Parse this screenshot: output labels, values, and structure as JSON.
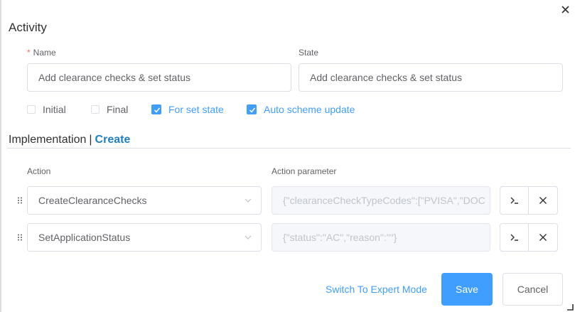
{
  "dialog": {
    "title": "Activity",
    "close_icon": "close-icon"
  },
  "form": {
    "name_label": "Name",
    "name_required_marker": "*",
    "name_value": "Add clearance checks & set status",
    "state_label": "State",
    "state_value": "Add clearance checks & set status",
    "checkboxes": [
      {
        "label": "Initial",
        "checked": false
      },
      {
        "label": "Final",
        "checked": false
      },
      {
        "label": "For set state",
        "checked": true
      },
      {
        "label": "Auto scheme update",
        "checked": true
      }
    ]
  },
  "implementation": {
    "title": "Implementation",
    "separator": "|",
    "link": "Create",
    "columns": {
      "action": "Action",
      "parameter": "Action parameter"
    },
    "rows": [
      {
        "action": "CreateClearanceChecks",
        "parameter": "{\"clearanceCheckTypeCodes\":[\"PVISA\",\"DOC"
      },
      {
        "action": "SetApplicationStatus",
        "parameter": "{\"status\":\"AC\",\"reason\":\"\"}"
      }
    ]
  },
  "footer": {
    "expert_mode": "Switch To Expert Mode",
    "save": "Save",
    "cancel": "Cancel"
  },
  "colors": {
    "primary": "#409eff",
    "link": "#1e7fc4",
    "required": "#f56c6c",
    "border": "#dcdfe6"
  }
}
